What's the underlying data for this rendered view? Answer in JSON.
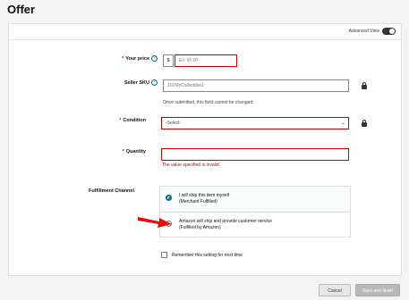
{
  "page": {
    "title": "Offer"
  },
  "advanced_view": {
    "label": "Advanced View",
    "enabled": true
  },
  "form": {
    "price": {
      "label": "Your price",
      "required_mark": "*",
      "currency": "$",
      "placeholder": "Ex: 50.00"
    },
    "sku": {
      "label": "Seller SKU",
      "placeholder": "101MyCollectible1",
      "hint": "Once submitted, this field cannot be changed"
    },
    "condition": {
      "label": "Condition",
      "required_mark": "*",
      "value": "-Select-"
    },
    "quantity": {
      "label": "Quantity",
      "required_mark": "*",
      "value": "",
      "error": "The value specified is invalid."
    },
    "fulfillment": {
      "label": "Fulfillment Channel",
      "options": [
        {
          "line1": "I will ship this item myself",
          "line2": "(Merchant Fulfilled)",
          "selected": true
        },
        {
          "line1": "Amazon will ship and provide customer service",
          "line2": "(Fulfilled by Amazon)",
          "selected": false
        }
      ]
    },
    "remember": {
      "label": "Remember this setting for next time",
      "checked": false
    }
  },
  "buttons": {
    "cancel": "Cancel",
    "save": "Save and finish"
  },
  "icons": {
    "help": "help-icon",
    "lock": "lock-icon",
    "arrow": "red-arrow-annotation",
    "chevron": "chevron-down-icon"
  },
  "colors": {
    "error": "#c40000",
    "link": "#007185",
    "arrow": "#e01010"
  }
}
